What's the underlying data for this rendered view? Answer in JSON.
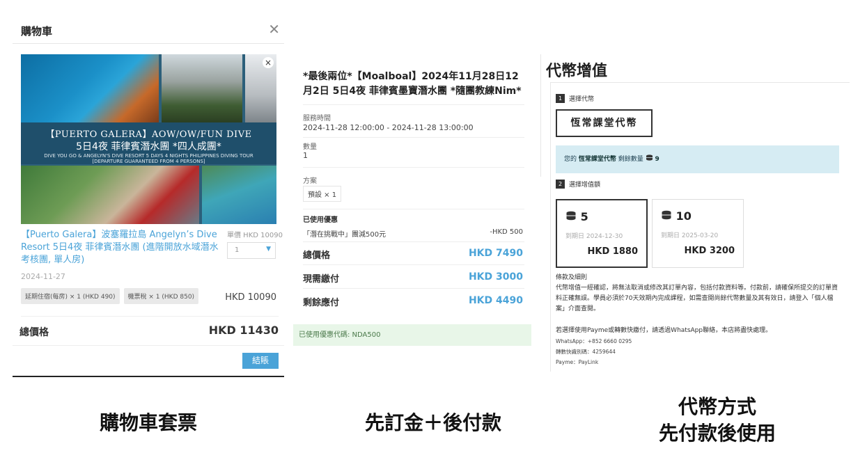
{
  "cart": {
    "title": "購物車",
    "close_icon": "✕",
    "banner": {
      "line1": "【PUERTO GALERA】AOW/OW/FUN DIVE",
      "line2": "5日4夜 菲律賓潛水團 *四人成團*",
      "line3": "DIVE YOU GO & ANGELYN'S DIVE RESORT 5 DAYS 4 NIGHTS PHILIPPINES DIVING TOUR",
      "line4": "[DEPARTURE GUARANTEED FROM 4 PERSONS]",
      "remove_icon": "×"
    },
    "product_title": "【Puerto Galera】波塞羅拉島 Angelyn’s Dive Resort 5日4夜 菲律賓潛水團 (進階開放水域潛水考核團, 單人房)",
    "unit_price": "單價 HKD 10090",
    "quantity": "1",
    "quantity_arrow": "▼",
    "date": "2024-11-27",
    "addons": [
      "延期住宿(每房) × 1 (HKD 490)",
      "機票稅 × 1 (HKD 850)"
    ],
    "item_total": "HKD 10090",
    "total_label": "總價格",
    "total_value": "HKD 11430",
    "checkout_label": "結賬"
  },
  "order": {
    "title": "*最後兩位*【Moalboal】2024年11月28日12月2日 5日4夜 菲律賓墨寶潛水團 *隨團教練Nim*",
    "service_time_label": "服務時間",
    "service_time_value": "2024-11-28 12:00:00 - 2024-11-28 13:00:00",
    "quantity_label": "數量",
    "quantity_value": "1",
    "plan_label": "方案",
    "plan_value": "預設 × 1",
    "discount_title": "已使用優惠",
    "discount_name": "「潛在挑戰中」團減500元",
    "discount_value": "-HKD 500",
    "summary": [
      {
        "label": "總價格",
        "value": "HKD 7490"
      },
      {
        "label": "現需繳付",
        "value": "HKD 3000"
      },
      {
        "label": "剩餘應付",
        "value": "HKD 4490"
      }
    ],
    "coupon_used": "已使用優惠代碼: NDA500"
  },
  "token": {
    "title": "代幣增值",
    "step1_num": "1",
    "step1_label": "選擇代幣",
    "token_name": "恆常課堂代幣",
    "balance_prefix": "您的",
    "balance_token": "恆常課堂代幣",
    "balance_suffix": "剩餘數量",
    "balance_icon": "coins-icon",
    "balance_count": "9",
    "step2_num": "2",
    "step2_label": "選擇增值額",
    "options": [
      {
        "qty": "5",
        "expiry": "到期日 2024-12-30",
        "price": "HKD 1880",
        "selected": true
      },
      {
        "qty": "10",
        "expiry": "到期日 2025-03-20",
        "price": "HKD 3200",
        "selected": false
      }
    ],
    "terms_title": "條款及細則",
    "terms_body": "代幣增值一經確認，將無法取消或修改其訂單內容，包括付款資料等。付款前，請確保所提交的訂單資料正確無誤。學員必須於70天效期內完成課程，如需查閱尚餘代幣數量及其有效日，請登入「個人檔案」介面查閱。",
    "pay_note": "若選擇使用Payme或轉數快繳付，請透過WhatsApp聯絡，本店將盡快處理。",
    "whatsapp": "WhatsApp：+852 6660 0295",
    "fps": "轉數快識別碼：4259644",
    "payme": "Payme：PayLink"
  },
  "captions": {
    "left": "購物車套票",
    "middle": "先訂金＋後付款",
    "right_line1": "代幣方式",
    "right_line2": "先付款後使用"
  },
  "colors": {
    "accent_blue": "#4aa3d8",
    "balance_bg": "#d6ecf3",
    "coupon_bg": "#e8f6e8"
  }
}
